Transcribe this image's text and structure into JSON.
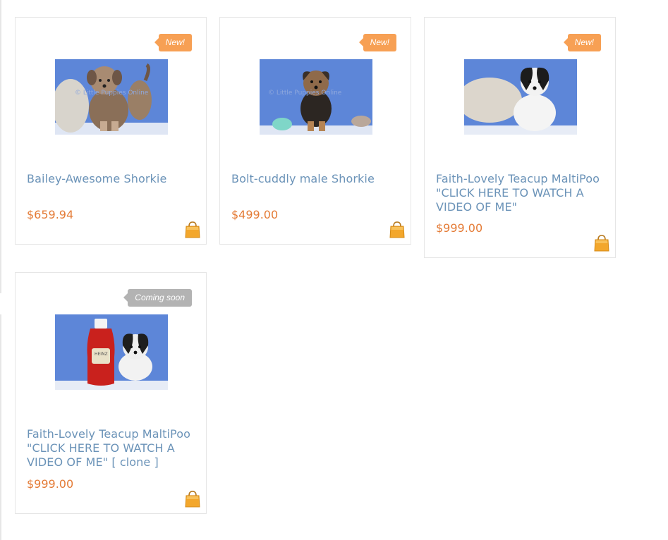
{
  "products": [
    {
      "badge": "New!",
      "badge_type": "new",
      "title": "Bailey-Awesome Shorkie",
      "price": "$659.94",
      "image_icon": "puppy-photo",
      "watermark": "© Little Puppies Online"
    },
    {
      "badge": "New!",
      "badge_type": "new",
      "title": "Bolt-cuddly male Shorkie",
      "price": "$499.00",
      "image_icon": "puppy-photo",
      "watermark": "© Little Puppies Online"
    },
    {
      "badge": "New!",
      "badge_type": "new",
      "title": "Faith-Lovely Teacup MaltiPoo \"CLICK HERE TO WATCH A VIDEO OF ME\"",
      "price": "$999.00",
      "image_icon": "puppy-photo"
    },
    {
      "badge": "Coming soon",
      "badge_type": "soon",
      "title": "Faith-Lovely Teacup MaltiPoo \"CLICK HERE TO WATCH A VIDEO OF ME\" [ clone ]",
      "price": "$999.00",
      "image_icon": "puppy-photo",
      "bottle_label": "HEINZ"
    }
  ],
  "cart_icon": "shopping-bag-icon",
  "colors": {
    "title": "#6b93b8",
    "price": "#e47b36",
    "badge_new": "#f7a054",
    "badge_soon": "#b3b3b3",
    "border": "#e6e6e6"
  }
}
